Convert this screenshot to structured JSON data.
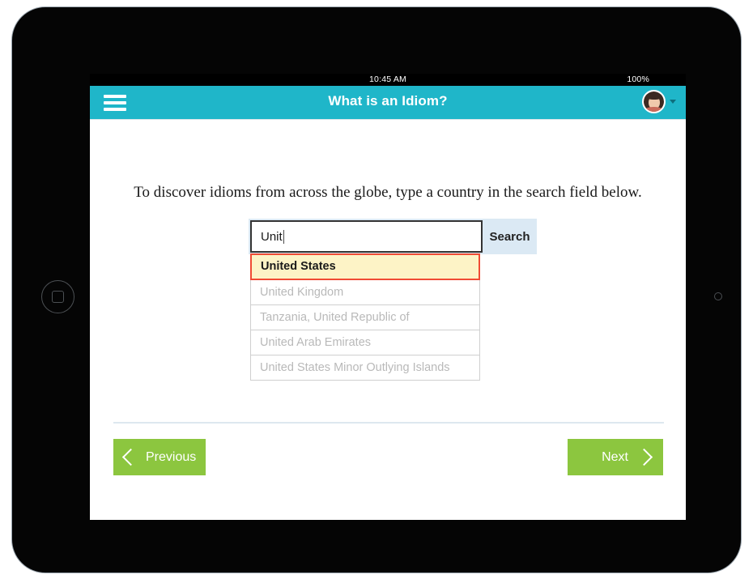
{
  "device": {
    "home_button": "home-button",
    "camera": "front-camera"
  },
  "status_bar": {
    "time": "10:45 AM",
    "battery": "100%"
  },
  "app_bar": {
    "menu_icon": "hamburger-menu-icon",
    "title": "What is an Idiom?",
    "avatar": "user-avatar",
    "caret_icon": "chevron-down-icon",
    "background_color": "#1fb6c9"
  },
  "content": {
    "instruction": "To discover idioms from across the globe, type a country in the search field below.",
    "search": {
      "value": "Unit",
      "placeholder": "",
      "button_label": "Search",
      "field_background": "#ffffff",
      "row_background": "#dbe9f4"
    },
    "suggestions": [
      {
        "label": "United States",
        "selected": true
      },
      {
        "label": "United Kingdom",
        "selected": false
      },
      {
        "label": "Tanzania, United Republic of",
        "selected": false
      },
      {
        "label": "United Arab Emirates",
        "selected": false
      },
      {
        "label": "United States Minor Outlying Islands",
        "selected": false
      }
    ],
    "selected_colors": {
      "background": "#fdf3c6",
      "border": "#f04b34",
      "text": "#1a1a1a"
    }
  },
  "footer": {
    "previous_label": "Previous",
    "next_label": "Next",
    "button_color": "#8cc63f",
    "prev_icon": "chevron-left-icon",
    "next_icon": "chevron-right-icon"
  }
}
